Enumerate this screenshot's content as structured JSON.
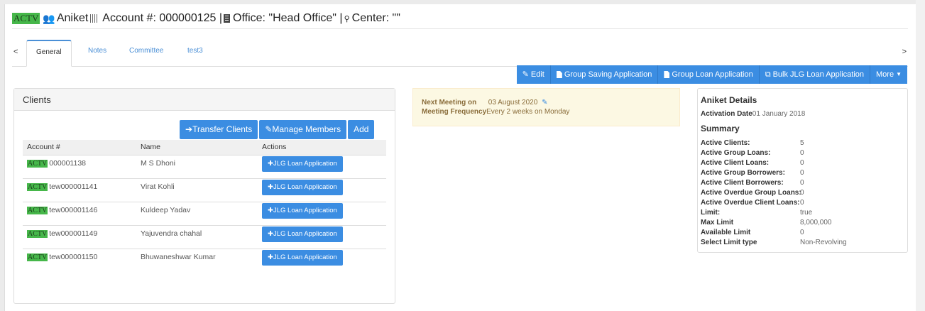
{
  "header": {
    "status": "ACTV",
    "name": "Aniket",
    "account": "Account #: 000000125 |",
    "office": "Office: \"Head Office\" |",
    "center": "Center: \"\""
  },
  "tabs": [
    {
      "label": "General",
      "active": true
    },
    {
      "label": "Notes"
    },
    {
      "label": "Committee"
    },
    {
      "label": "test3"
    }
  ],
  "actions": {
    "edit": "Edit",
    "group_saving": "Group Saving Application",
    "group_loan": "Group Loan Application",
    "bulk_jlg": "Bulk JLG Loan Application",
    "more": "More"
  },
  "clients": {
    "title": "Clients",
    "transfer": "Transfer Clients",
    "manage": "Manage Members",
    "add": "Add",
    "columns": [
      "Account #",
      "Name",
      "Actions"
    ],
    "jlg_label": "JLG Loan Application",
    "rows": [
      {
        "status": "ACTV",
        "account": "000001138",
        "name": "M S Dhoni"
      },
      {
        "status": "ACTV",
        "account": "tew000001141",
        "name": "Virat Kohli"
      },
      {
        "status": "ACTV",
        "account": "tew000001146",
        "name": "Kuldeep Yadav"
      },
      {
        "status": "ACTV",
        "account": "tew000001149",
        "name": "Yajuvendra chahal"
      },
      {
        "status": "ACTV",
        "account": "tew000001150",
        "name": "Bhuwaneshwar Kumar"
      }
    ]
  },
  "meeting": {
    "next_label": "Next Meeting on",
    "next_value": "03 August 2020",
    "freq_label": "Meeting Frequency",
    "freq_value": "Every 2 weeks on Monday"
  },
  "details": {
    "title": "Aniket Details",
    "activation_label": "Activation Date",
    "activation_value": "01 January 2018",
    "summary_title": "Summary",
    "summary": [
      {
        "k": "Active Clients:",
        "v": "5"
      },
      {
        "k": "Active Group Loans:",
        "v": "0"
      },
      {
        "k": "Active Client Loans:",
        "v": "0"
      },
      {
        "k": "Active Group Borrowers:",
        "v": "0"
      },
      {
        "k": "Active Client Borrowers:",
        "v": "0"
      },
      {
        "k": "Active Overdue Group Loans:",
        "v": "0"
      },
      {
        "k": "Active Overdue Client Loans:",
        "v": "0"
      },
      {
        "k": "Limit:",
        "v": "true"
      },
      {
        "k": "Max Limit",
        "v": "8,000,000"
      },
      {
        "k": "Available Limit",
        "v": "0"
      },
      {
        "k": "Select Limit type",
        "v": "Non-Revolving"
      }
    ]
  },
  "colors": {
    "primary": "#3b8de2",
    "status_green": "#46b74a",
    "warning_bg": "#fcf8e3"
  }
}
